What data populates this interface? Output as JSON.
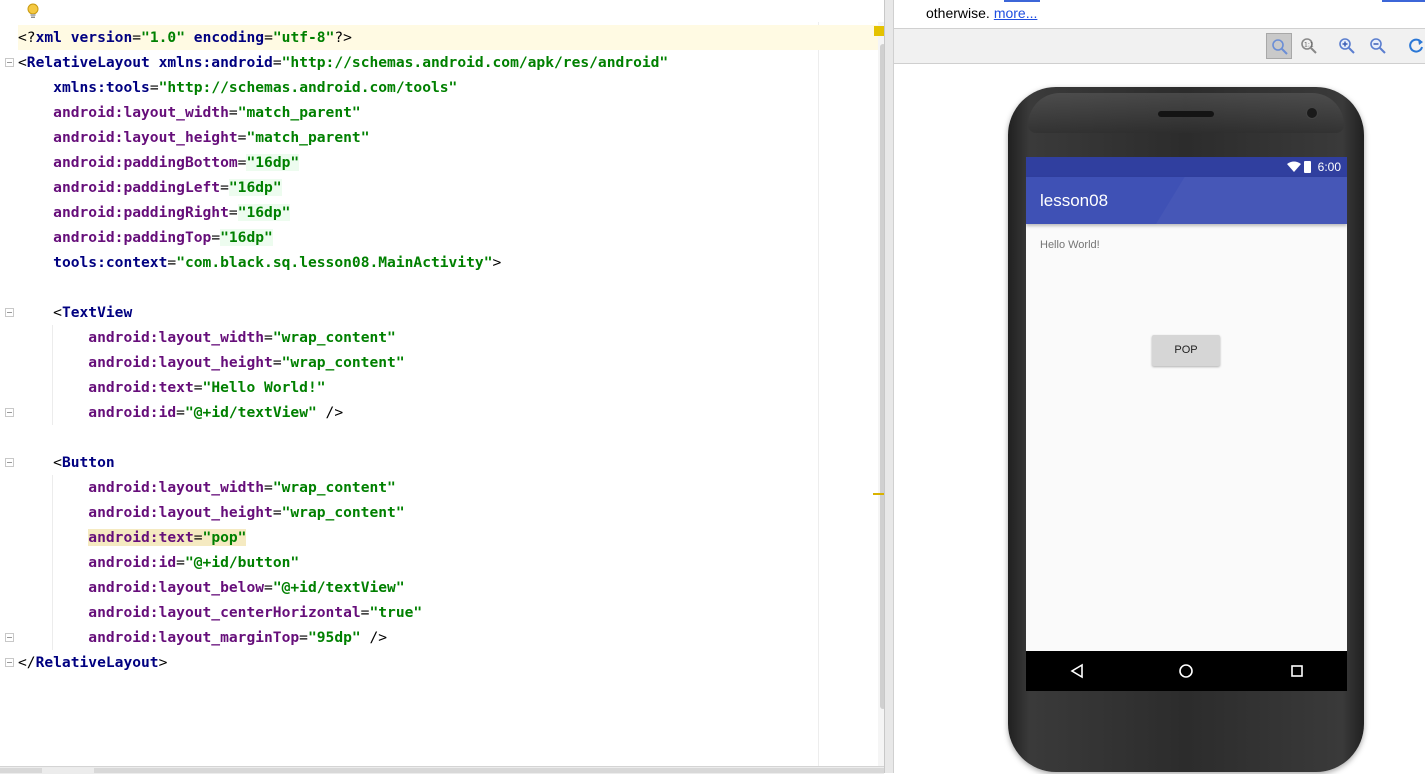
{
  "editor": {
    "lines": [
      [
        {
          "t": "<?",
          "c": "punct"
        },
        {
          "t": "xml ",
          "c": "tag"
        },
        {
          "t": "version",
          "c": "ns"
        },
        {
          "t": "=",
          "c": "punct"
        },
        {
          "t": "\"1.0\"",
          "c": "val"
        },
        {
          "t": " ",
          "c": "punct"
        },
        {
          "t": "encoding",
          "c": "ns"
        },
        {
          "t": "=",
          "c": "punct"
        },
        {
          "t": "\"utf-8\"",
          "c": "val"
        },
        {
          "t": "?>",
          "c": "punct"
        }
      ],
      [
        {
          "t": "<",
          "c": "punct"
        },
        {
          "t": "RelativeLayout ",
          "c": "tag"
        },
        {
          "t": "xmlns:android",
          "c": "ns"
        },
        {
          "t": "=",
          "c": "punct"
        },
        {
          "t": "\"http://schemas.android.com/apk/res/android\"",
          "c": "val"
        }
      ],
      [
        {
          "t": "    ",
          "c": "punct"
        },
        {
          "t": "xmlns:tools",
          "c": "ns"
        },
        {
          "t": "=",
          "c": "punct"
        },
        {
          "t": "\"http://schemas.android.com/tools\"",
          "c": "val"
        }
      ],
      [
        {
          "t": "    ",
          "c": "punct"
        },
        {
          "t": "android:layout_width",
          "c": "attr"
        },
        {
          "t": "=",
          "c": "punct"
        },
        {
          "t": "\"match_parent\"",
          "c": "val"
        }
      ],
      [
        {
          "t": "    ",
          "c": "punct"
        },
        {
          "t": "android:layout_height",
          "c": "attr"
        },
        {
          "t": "=",
          "c": "punct"
        },
        {
          "t": "\"match_parent\"",
          "c": "val"
        }
      ],
      [
        {
          "t": "    ",
          "c": "punct"
        },
        {
          "t": "android:paddingBottom",
          "c": "attr"
        },
        {
          "t": "=",
          "c": "punct"
        },
        {
          "t": "\"16dp\"",
          "c": "val hl-num"
        }
      ],
      [
        {
          "t": "    ",
          "c": "punct"
        },
        {
          "t": "android:paddingLeft",
          "c": "attr"
        },
        {
          "t": "=",
          "c": "punct"
        },
        {
          "t": "\"16dp\"",
          "c": "val hl-num"
        }
      ],
      [
        {
          "t": "    ",
          "c": "punct"
        },
        {
          "t": "android:paddingRight",
          "c": "attr"
        },
        {
          "t": "=",
          "c": "punct"
        },
        {
          "t": "\"16dp\"",
          "c": "val hl-num"
        }
      ],
      [
        {
          "t": "    ",
          "c": "punct"
        },
        {
          "t": "android:paddingTop",
          "c": "attr"
        },
        {
          "t": "=",
          "c": "punct"
        },
        {
          "t": "\"16dp\"",
          "c": "val hl-num"
        }
      ],
      [
        {
          "t": "    ",
          "c": "punct"
        },
        {
          "t": "tools:context",
          "c": "ns"
        },
        {
          "t": "=",
          "c": "punct"
        },
        {
          "t": "\"com.black.sq.lesson08.MainActivity\"",
          "c": "val"
        },
        {
          "t": ">",
          "c": "punct"
        }
      ],
      [],
      [
        {
          "t": "    <",
          "c": "punct"
        },
        {
          "t": "TextView",
          "c": "tag"
        }
      ],
      [
        {
          "t": "        ",
          "c": "punct"
        },
        {
          "t": "android:layout_width",
          "c": "attr"
        },
        {
          "t": "=",
          "c": "punct"
        },
        {
          "t": "\"wrap_content\"",
          "c": "val"
        }
      ],
      [
        {
          "t": "        ",
          "c": "punct"
        },
        {
          "t": "android:layout_height",
          "c": "attr"
        },
        {
          "t": "=",
          "c": "punct"
        },
        {
          "t": "\"wrap_content\"",
          "c": "val"
        }
      ],
      [
        {
          "t": "        ",
          "c": "punct"
        },
        {
          "t": "android:text",
          "c": "attr"
        },
        {
          "t": "=",
          "c": "punct"
        },
        {
          "t": "\"Hello World!\"",
          "c": "val"
        }
      ],
      [
        {
          "t": "        ",
          "c": "punct"
        },
        {
          "t": "android:id",
          "c": "attr"
        },
        {
          "t": "=",
          "c": "punct"
        },
        {
          "t": "\"@+id/textView\"",
          "c": "val"
        },
        {
          "t": " />",
          "c": "punct"
        }
      ],
      [],
      [
        {
          "t": "    <",
          "c": "punct"
        },
        {
          "t": "Button",
          "c": "tag"
        }
      ],
      [
        {
          "t": "        ",
          "c": "punct"
        },
        {
          "t": "android:layout_width",
          "c": "attr"
        },
        {
          "t": "=",
          "c": "punct"
        },
        {
          "t": "\"wrap_content\"",
          "c": "val"
        }
      ],
      [
        {
          "t": "        ",
          "c": "punct"
        },
        {
          "t": "android:layout_height",
          "c": "attr"
        },
        {
          "t": "=",
          "c": "punct"
        },
        {
          "t": "\"wrap_content\"",
          "c": "val"
        }
      ],
      [
        {
          "t": "        ",
          "c": "punct"
        },
        {
          "t": "android:text",
          "c": "attr hl-warn"
        },
        {
          "t": "=",
          "c": "punct hl-warn"
        },
        {
          "t": "\"pop\"",
          "c": "val hl-warn"
        }
      ],
      [
        {
          "t": "        ",
          "c": "punct"
        },
        {
          "t": "android:id",
          "c": "attr"
        },
        {
          "t": "=",
          "c": "punct"
        },
        {
          "t": "\"@+id/button\"",
          "c": "val"
        }
      ],
      [
        {
          "t": "        ",
          "c": "punct"
        },
        {
          "t": "android:layout_below",
          "c": "attr"
        },
        {
          "t": "=",
          "c": "punct"
        },
        {
          "t": "\"@+id/textView\"",
          "c": "val"
        }
      ],
      [
        {
          "t": "        ",
          "c": "punct"
        },
        {
          "t": "android:layout_centerHorizontal",
          "c": "attr"
        },
        {
          "t": "=",
          "c": "punct"
        },
        {
          "t": "\"true\"",
          "c": "val"
        }
      ],
      [
        {
          "t": "        ",
          "c": "punct"
        },
        {
          "t": "android:layout_marginTop",
          "c": "attr"
        },
        {
          "t": "=",
          "c": "punct"
        },
        {
          "t": "\"95dp\"",
          "c": "val"
        },
        {
          "t": " />",
          "c": "punct"
        }
      ],
      [
        {
          "t": "</",
          "c": "punct"
        },
        {
          "t": "RelativeLayout",
          "c": "tag"
        },
        {
          "t": ">",
          "c": "punct"
        }
      ]
    ]
  },
  "notice": {
    "text": "otherwise.",
    "more_link": "more..."
  },
  "toolbar": {
    "buttons": [
      "zoom-actual-icon",
      "zoom-fit-icon",
      "zoom-in-icon",
      "zoom-out-icon",
      "refresh-icon"
    ]
  },
  "device": {
    "status_time": "6:00",
    "app_title": "lesson08",
    "hello_text": "Hello World!",
    "button_label": "POP"
  },
  "colors": {
    "primary": "#3f51b5",
    "primary_dark": "#303f9f"
  }
}
